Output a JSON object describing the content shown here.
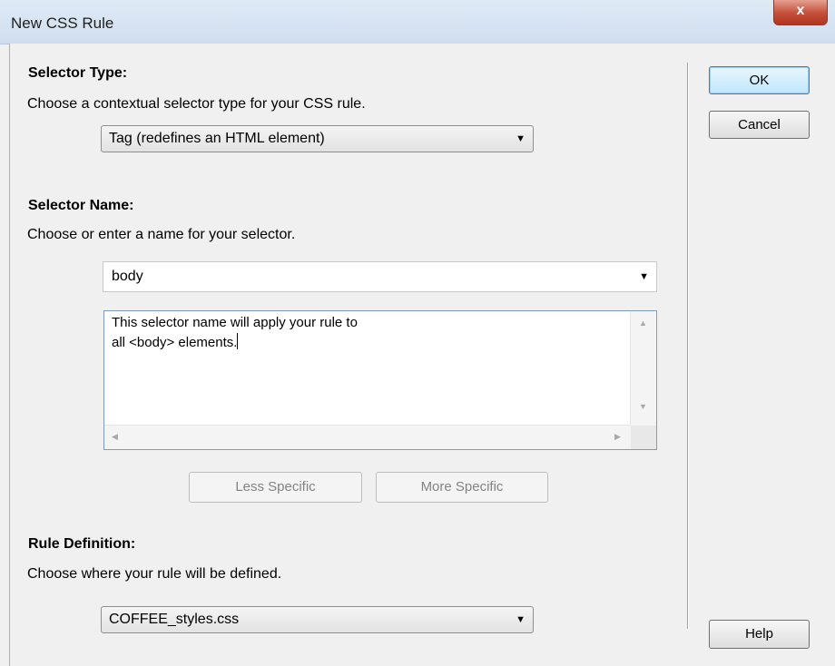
{
  "window": {
    "title": "New CSS Rule",
    "close_glyph": "x"
  },
  "selector_type": {
    "heading": "Selector Type:",
    "description": "Choose a contextual selector type for your CSS rule.",
    "value": "Tag (redefines an HTML element)"
  },
  "selector_name": {
    "heading": "Selector Name:",
    "description": "Choose or enter a name for your selector.",
    "value": "body",
    "info_line1": "This selector name will apply your rule to",
    "info_line2": "all <body> elements."
  },
  "specificity": {
    "less_label": "Less Specific",
    "more_label": "More Specific"
  },
  "rule_definition": {
    "heading": "Rule Definition:",
    "description": "Choose where your rule will be defined.",
    "value": "COFFEE_styles.css"
  },
  "buttons": {
    "ok": "OK",
    "cancel": "Cancel",
    "help": "Help"
  },
  "icons": {
    "dropdown": "chevron-down-icon",
    "close": "close-icon"
  },
  "colors": {
    "titlebar": "#cfdeef",
    "close": "#c4503a",
    "default_button": "#bee6fd"
  }
}
